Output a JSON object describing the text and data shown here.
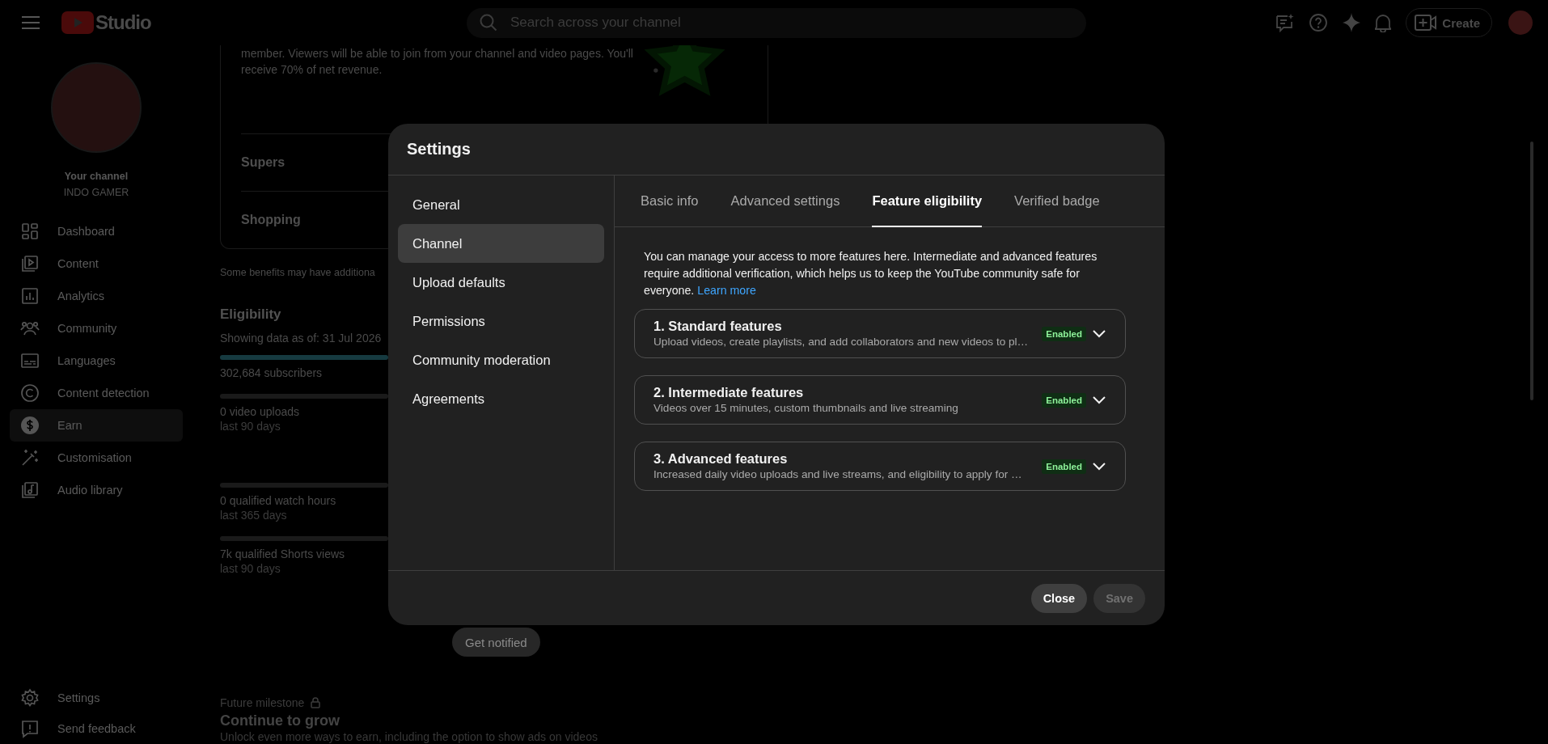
{
  "topbar": {
    "logo_text": "Studio",
    "search": {
      "placeholder": "Search across your channel"
    },
    "create_button": "Create"
  },
  "sidebar": {
    "channel_label": "Your channel",
    "channel_name": "INDO GAMER",
    "items": [
      {
        "label": "Dashboard",
        "selected": false
      },
      {
        "label": "Content",
        "selected": false
      },
      {
        "label": "Analytics",
        "selected": false
      },
      {
        "label": "Community",
        "selected": false
      },
      {
        "label": "Languages",
        "selected": false
      },
      {
        "label": "Content detection",
        "selected": false
      },
      {
        "label": "Earn",
        "selected": true
      },
      {
        "label": "Customisation",
        "selected": false
      },
      {
        "label": "Audio library",
        "selected": false
      }
    ],
    "bottom_items": [
      {
        "label": "Settings"
      },
      {
        "label": "Send feedback"
      }
    ]
  },
  "page": {
    "membership_text": "member. Viewers will be able to join from your channel and video pages. You'll receive 70% of net revenue.",
    "sections": [
      "Supers",
      "Shopping"
    ],
    "note": "Some benefits may have additiona",
    "eligibility": {
      "title": "Eligibility",
      "as_of": "Showing data as of: 31 Jul 2026",
      "metrics": [
        {
          "value": "302,684 subscribers",
          "level": 1
        },
        {
          "value": "0 video uploads",
          "period": "last 90 days"
        },
        {
          "value": "0 qualified watch hours",
          "period": "last 365 days"
        },
        {
          "value": "7k qualified Shorts views",
          "period": "last 90 days"
        }
      ]
    },
    "notify_button": "Get notified",
    "milestone": {
      "label": "Future milestone",
      "title": "Continue to grow",
      "description": "Unlock even more ways to earn, including the option to show ads on videos"
    }
  },
  "settings_dialog": {
    "title": "Settings",
    "nav": [
      {
        "label": "General",
        "selected": false
      },
      {
        "label": "Channel",
        "selected": true
      },
      {
        "label": "Upload defaults",
        "selected": false
      },
      {
        "label": "Permissions",
        "selected": false
      },
      {
        "label": "Community moderation",
        "selected": false
      },
      {
        "label": "Agreements",
        "selected": false
      }
    ],
    "tabs": [
      {
        "label": "Basic info",
        "selected": false
      },
      {
        "label": "Advanced settings",
        "selected": false
      },
      {
        "label": "Feature eligibility",
        "selected": true
      },
      {
        "label": "Verified badge",
        "selected": false
      }
    ],
    "description": "You can manage your access to more features here. Intermediate and advanced features require additional verification, which helps us to keep the YouTube community safe for everyone.",
    "learn_more": "Learn more",
    "features": [
      {
        "title": "1. Standard features",
        "description": "Upload videos, create playlists, and add collaborators and new videos to pl…",
        "status": "Enabled",
        "expanded": false
      },
      {
        "title": "2. Intermediate features",
        "description": "Videos over 15 minutes, custom thumbnails and live streaming",
        "status": "Enabled",
        "expanded": false
      },
      {
        "title": "3. Advanced features",
        "description": "Increased daily video uploads and live streams, and eligibility to apply for …",
        "status": "Enabled",
        "expanded": false
      }
    ],
    "buttons": [
      {
        "label": "Close",
        "disabled": false
      },
      {
        "label": "Save",
        "disabled": true
      }
    ]
  }
}
